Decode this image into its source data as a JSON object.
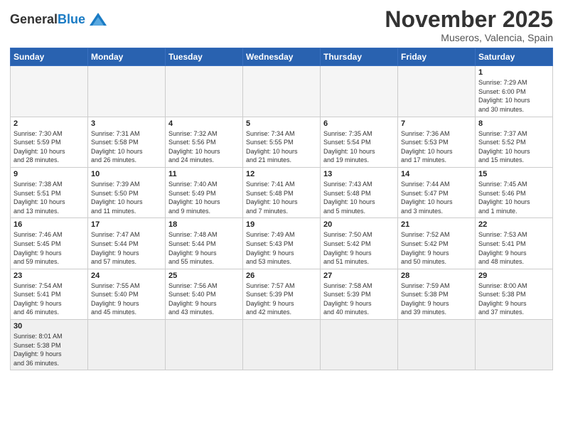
{
  "logo": {
    "text_general": "General",
    "text_blue": "Blue"
  },
  "header": {
    "month": "November 2025",
    "location": "Museros, Valencia, Spain"
  },
  "weekdays": [
    "Sunday",
    "Monday",
    "Tuesday",
    "Wednesday",
    "Thursday",
    "Friday",
    "Saturday"
  ],
  "weeks": [
    [
      {
        "day": "",
        "info": "",
        "empty": true
      },
      {
        "day": "",
        "info": "",
        "empty": true
      },
      {
        "day": "",
        "info": "",
        "empty": true
      },
      {
        "day": "",
        "info": "",
        "empty": true
      },
      {
        "day": "",
        "info": "",
        "empty": true
      },
      {
        "day": "",
        "info": "",
        "empty": true
      },
      {
        "day": "1",
        "info": "Sunrise: 7:29 AM\nSunset: 6:00 PM\nDaylight: 10 hours\nand 30 minutes."
      }
    ],
    [
      {
        "day": "2",
        "info": "Sunrise: 7:30 AM\nSunset: 5:59 PM\nDaylight: 10 hours\nand 28 minutes."
      },
      {
        "day": "3",
        "info": "Sunrise: 7:31 AM\nSunset: 5:58 PM\nDaylight: 10 hours\nand 26 minutes."
      },
      {
        "day": "4",
        "info": "Sunrise: 7:32 AM\nSunset: 5:56 PM\nDaylight: 10 hours\nand 24 minutes."
      },
      {
        "day": "5",
        "info": "Sunrise: 7:34 AM\nSunset: 5:55 PM\nDaylight: 10 hours\nand 21 minutes."
      },
      {
        "day": "6",
        "info": "Sunrise: 7:35 AM\nSunset: 5:54 PM\nDaylight: 10 hours\nand 19 minutes."
      },
      {
        "day": "7",
        "info": "Sunrise: 7:36 AM\nSunset: 5:53 PM\nDaylight: 10 hours\nand 17 minutes."
      },
      {
        "day": "8",
        "info": "Sunrise: 7:37 AM\nSunset: 5:52 PM\nDaylight: 10 hours\nand 15 minutes."
      }
    ],
    [
      {
        "day": "9",
        "info": "Sunrise: 7:38 AM\nSunset: 5:51 PM\nDaylight: 10 hours\nand 13 minutes."
      },
      {
        "day": "10",
        "info": "Sunrise: 7:39 AM\nSunset: 5:50 PM\nDaylight: 10 hours\nand 11 minutes."
      },
      {
        "day": "11",
        "info": "Sunrise: 7:40 AM\nSunset: 5:49 PM\nDaylight: 10 hours\nand 9 minutes."
      },
      {
        "day": "12",
        "info": "Sunrise: 7:41 AM\nSunset: 5:48 PM\nDaylight: 10 hours\nand 7 minutes."
      },
      {
        "day": "13",
        "info": "Sunrise: 7:43 AM\nSunset: 5:48 PM\nDaylight: 10 hours\nand 5 minutes."
      },
      {
        "day": "14",
        "info": "Sunrise: 7:44 AM\nSunset: 5:47 PM\nDaylight: 10 hours\nand 3 minutes."
      },
      {
        "day": "15",
        "info": "Sunrise: 7:45 AM\nSunset: 5:46 PM\nDaylight: 10 hours\nand 1 minute."
      }
    ],
    [
      {
        "day": "16",
        "info": "Sunrise: 7:46 AM\nSunset: 5:45 PM\nDaylight: 9 hours\nand 59 minutes."
      },
      {
        "day": "17",
        "info": "Sunrise: 7:47 AM\nSunset: 5:44 PM\nDaylight: 9 hours\nand 57 minutes."
      },
      {
        "day": "18",
        "info": "Sunrise: 7:48 AM\nSunset: 5:44 PM\nDaylight: 9 hours\nand 55 minutes."
      },
      {
        "day": "19",
        "info": "Sunrise: 7:49 AM\nSunset: 5:43 PM\nDaylight: 9 hours\nand 53 minutes."
      },
      {
        "day": "20",
        "info": "Sunrise: 7:50 AM\nSunset: 5:42 PM\nDaylight: 9 hours\nand 51 minutes."
      },
      {
        "day": "21",
        "info": "Sunrise: 7:52 AM\nSunset: 5:42 PM\nDaylight: 9 hours\nand 50 minutes."
      },
      {
        "day": "22",
        "info": "Sunrise: 7:53 AM\nSunset: 5:41 PM\nDaylight: 9 hours\nand 48 minutes."
      }
    ],
    [
      {
        "day": "23",
        "info": "Sunrise: 7:54 AM\nSunset: 5:41 PM\nDaylight: 9 hours\nand 46 minutes."
      },
      {
        "day": "24",
        "info": "Sunrise: 7:55 AM\nSunset: 5:40 PM\nDaylight: 9 hours\nand 45 minutes."
      },
      {
        "day": "25",
        "info": "Sunrise: 7:56 AM\nSunset: 5:40 PM\nDaylight: 9 hours\nand 43 minutes."
      },
      {
        "day": "26",
        "info": "Sunrise: 7:57 AM\nSunset: 5:39 PM\nDaylight: 9 hours\nand 42 minutes."
      },
      {
        "day": "27",
        "info": "Sunrise: 7:58 AM\nSunset: 5:39 PM\nDaylight: 9 hours\nand 40 minutes."
      },
      {
        "day": "28",
        "info": "Sunrise: 7:59 AM\nSunset: 5:38 PM\nDaylight: 9 hours\nand 39 minutes."
      },
      {
        "day": "29",
        "info": "Sunrise: 8:00 AM\nSunset: 5:38 PM\nDaylight: 9 hours\nand 37 minutes."
      }
    ],
    [
      {
        "day": "30",
        "info": "Sunrise: 8:01 AM\nSunset: 5:38 PM\nDaylight: 9 hours\nand 36 minutes.",
        "lastrow": true
      },
      {
        "day": "",
        "info": "",
        "empty": true,
        "lastrow": true
      },
      {
        "day": "",
        "info": "",
        "empty": true,
        "lastrow": true
      },
      {
        "day": "",
        "info": "",
        "empty": true,
        "lastrow": true
      },
      {
        "day": "",
        "info": "",
        "empty": true,
        "lastrow": true
      },
      {
        "day": "",
        "info": "",
        "empty": true,
        "lastrow": true
      },
      {
        "day": "",
        "info": "",
        "empty": true,
        "lastrow": true
      }
    ]
  ]
}
